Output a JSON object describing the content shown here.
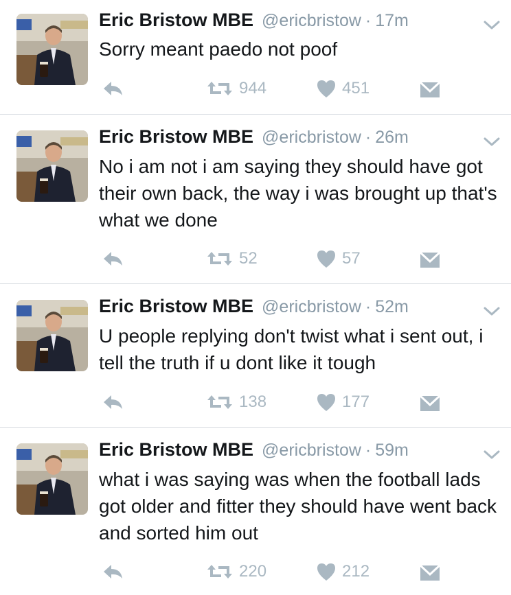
{
  "tweets": [
    {
      "display_name": "Eric Bristow MBE",
      "handle": "@ericbristow",
      "separator": "·",
      "time": "17m",
      "text": "Sorry meant paedo not poof",
      "retweets": "944",
      "likes": "451"
    },
    {
      "display_name": "Eric Bristow MBE",
      "handle": "@ericbristow",
      "separator": "·",
      "time": "26m",
      "text": "No i am not i am saying they should have got their own back, the way i was brought up that's what we done",
      "retweets": "52",
      "likes": "57"
    },
    {
      "display_name": "Eric Bristow MBE",
      "handle": "@ericbristow",
      "separator": "·",
      "time": "52m",
      "text": "U people replying don't twist what i sent out, i tell the truth if u dont like it tough",
      "retweets": "138",
      "likes": "177"
    },
    {
      "display_name": "Eric Bristow MBE",
      "handle": "@ericbristow",
      "separator": "·",
      "time": "59m",
      "text": "what i was saying was when the football lads got older and fitter they should have went back and sorted him out",
      "retweets": "220",
      "likes": "212"
    }
  ],
  "icons": {
    "reply": "reply-icon",
    "retweet": "retweet-icon",
    "like": "heart-icon",
    "message": "direct-message-icon",
    "menu": "chevron-down-icon"
  },
  "colors": {
    "icon_gray": "#aab8c2",
    "meta_gray": "#8899a6",
    "text": "#14171a",
    "divider": "#d6dbe0"
  }
}
